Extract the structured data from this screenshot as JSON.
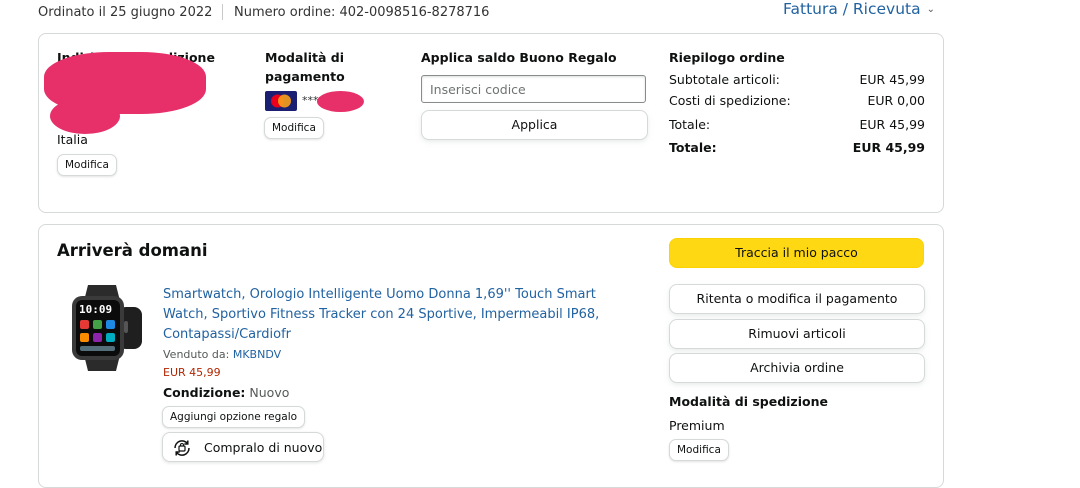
{
  "header": {
    "ordered_date": "Ordinato il 25 giugno 2022",
    "order_number": "Numero ordine: 402-0098516-8278716",
    "invoice_label": "Fattura / Ricevuta",
    "invoice_chevron": "⌄"
  },
  "shipping_address": {
    "title": "Indirizzo di spedizione",
    "country": "Italia",
    "edit_label": "Modifica"
  },
  "payment": {
    "title_line1": "Modalità di",
    "title_line2": "pagamento",
    "card_masked": "****",
    "edit_label": "Modifica"
  },
  "gift_card": {
    "title": "Applica saldo Buono Regalo",
    "placeholder": "Inserisci codice",
    "apply_label": "Applica"
  },
  "summary": {
    "title": "Riepilogo ordine",
    "rows": [
      {
        "label": "Subtotale articoli:",
        "value": "EUR 45,99"
      },
      {
        "label": "Costi di spedizione:",
        "value": "EUR 0,00"
      },
      {
        "label": "Totale:",
        "value": "EUR 45,99"
      },
      {
        "label": "Totale:",
        "value": "EUR 45,99"
      }
    ]
  },
  "shipment": {
    "status": "Arriverà domani",
    "product": {
      "title": "Smartwatch, Orologio Intelligente Uomo Donna 1,69'' Touch Smart Watch, Sportivo Fitness Tracker con 24 Sportive, Impermeabil IP68, Contapassi/Cardiofr",
      "sold_by_label": "Venduto da:",
      "seller": "MKBNDV",
      "price": "EUR 45,99",
      "condition_label": "Condizione:",
      "condition_value": "Nuovo",
      "gift_option_label": "Aggiungi opzione regalo",
      "buy_again_label": "Compralo di nuovo",
      "watch_time": "10:09"
    },
    "actions": {
      "track": "Traccia il mio pacco",
      "retry_payment": "Ritenta o modifica il pagamento",
      "remove_items": "Rimuovi articoli",
      "archive_order": "Archivia ordine"
    },
    "shipping_method": {
      "title": "Modalità di spedizione",
      "value": "Premium",
      "edit_label": "Modifica"
    }
  },
  "colors": {
    "link": "#2162a1",
    "price": "#b12704",
    "primary_button": "#ffd814",
    "redaction": "#e72f6a"
  }
}
